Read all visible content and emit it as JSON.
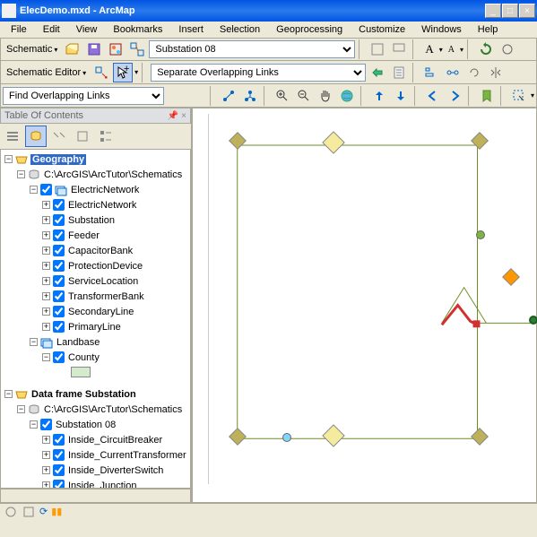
{
  "window": {
    "title": "ElecDemo.mxd - ArcMap"
  },
  "menu": [
    "File",
    "Edit",
    "View",
    "Bookmarks",
    "Insert",
    "Selection",
    "Geoprocessing",
    "Customize",
    "Windows",
    "Help"
  ],
  "toolbar1": {
    "schematicLabel": "Schematic",
    "layoutSel": "Substation 08",
    "aa": "A",
    "aa2": "A"
  },
  "toolbar2": {
    "editorLabel": "Schematic Editor",
    "layoutAlgo": "Separate Overlapping Links"
  },
  "toolbar3": {
    "task": "Find Overlapping Links"
  },
  "toc": {
    "title": "Table Of Contents",
    "geo": "Geography",
    "db1": "C:\\ArcGIS\\ArcTutor\\Schematics",
    "net": "ElectricNetwork",
    "layers1": [
      "ElectricNetwork",
      "Substation",
      "Feeder",
      "CapacitorBank",
      "ProtectionDevice",
      "ServiceLocation",
      "TransformerBank",
      "SecondaryLine",
      "PrimaryLine"
    ],
    "checked1": [
      true,
      true,
      true,
      true,
      true,
      true,
      true,
      true,
      true
    ],
    "landbase": "Landbase",
    "county": "County",
    "dfsub": "Data frame Substation",
    "db2": "C:\\ArcGIS\\ArcTutor\\Schematics",
    "sub08": "Substation 08",
    "layers2": [
      "Inside_CircuitBreaker",
      "Inside_CurrentTransformer",
      "Inside_DiverterSwitch",
      "Inside_Junction"
    ]
  },
  "colors": {
    "sel": "#316ac5"
  }
}
